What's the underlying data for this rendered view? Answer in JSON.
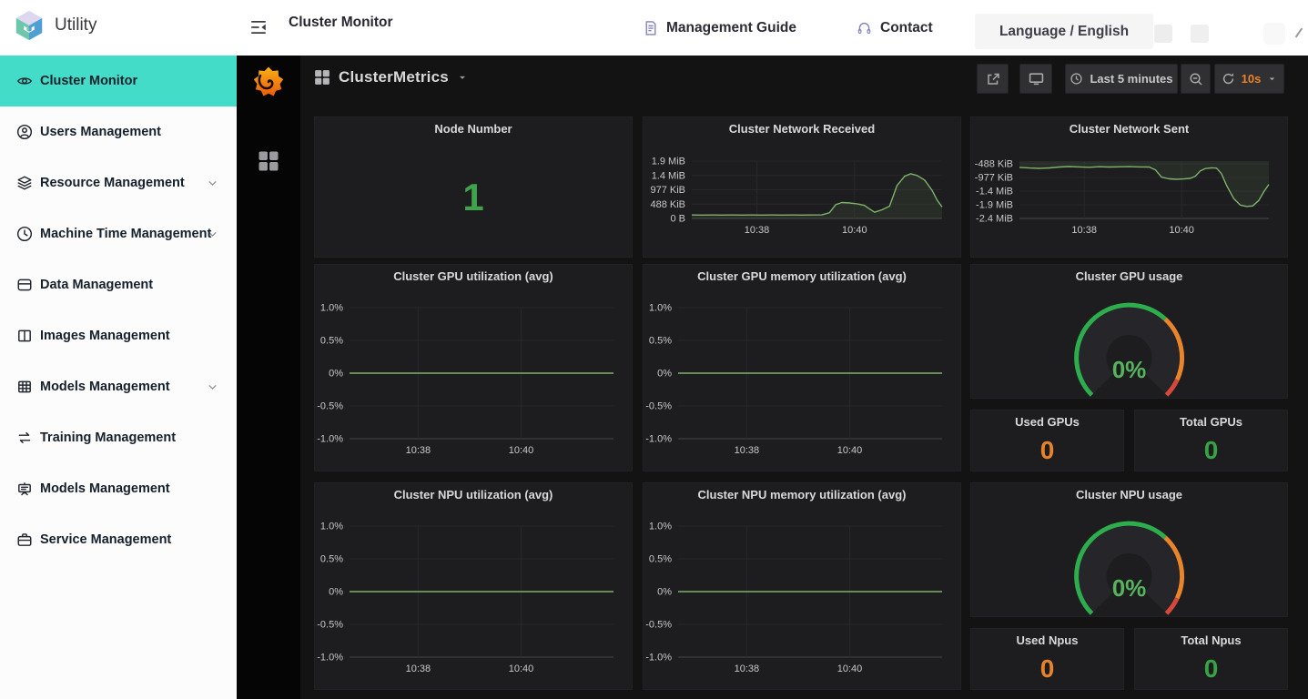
{
  "topbar": {
    "brand": "Utility",
    "page_title": "Cluster Monitor",
    "guide_label": "Management Guide",
    "contact_label": "Contact",
    "language_label": "Language / English"
  },
  "sidebar": {
    "items": [
      {
        "label": "Cluster Monitor",
        "icon": "eye",
        "active": true,
        "chevron": false
      },
      {
        "label": "Users Management",
        "icon": "user",
        "active": false,
        "chevron": false
      },
      {
        "label": "Resource Management",
        "icon": "layers",
        "active": false,
        "chevron": true
      },
      {
        "label": "Machine Time Management",
        "icon": "clock",
        "active": false,
        "chevron": true
      },
      {
        "label": "Data Management",
        "icon": "box",
        "active": false,
        "chevron": false
      },
      {
        "label": "Images Management",
        "icon": "book",
        "active": false,
        "chevron": false
      },
      {
        "label": "Models Management",
        "icon": "grid",
        "active": false,
        "chevron": true
      },
      {
        "label": "Training Management",
        "icon": "swap",
        "active": false,
        "chevron": false
      },
      {
        "label": "Models Management",
        "icon": "easel",
        "active": false,
        "chevron": false
      },
      {
        "label": "Service Management",
        "icon": "briefcase",
        "active": false,
        "chevron": false
      }
    ]
  },
  "dashboard": {
    "title": "ClusterMetrics",
    "time_range": "Last 5 minutes",
    "refresh_interval": "10s"
  },
  "colors": {
    "accent_teal": "#42dcc8",
    "stat_green": "#3fa34d",
    "stat_orange": "#e8832c",
    "line_green": "#7eb26d",
    "gauge_green": "#2dad4e",
    "gauge_orange": "#e8842a",
    "gauge_red": "#d44a3a"
  },
  "chart_data": [
    {
      "type": "stat",
      "title": "Node Number",
      "value": "1",
      "color": "#3fa34d",
      "size": 42
    },
    {
      "type": "line",
      "title": "Cluster Network Received",
      "color": "#7eb26d",
      "baseline": "bottom",
      "ylim": [
        0,
        2000
      ],
      "yticks": [
        {
          "v": 0,
          "label": "0 B"
        },
        {
          "v": 500,
          "label": "488 KiB"
        },
        {
          "v": 1000,
          "label": "977 KiB"
        },
        {
          "v": 1500,
          "label": "1.4 MiB"
        },
        {
          "v": 2000,
          "label": "1.9 MiB"
        }
      ],
      "xticks": [
        {
          "p": 0.26,
          "label": "10:38"
        },
        {
          "p": 0.65,
          "label": "10:40"
        }
      ],
      "series": [
        [
          0,
          120
        ],
        [
          0.04,
          117
        ],
        [
          0.08,
          122
        ],
        [
          0.12,
          118
        ],
        [
          0.16,
          121
        ],
        [
          0.2,
          119
        ],
        [
          0.24,
          122
        ],
        [
          0.28,
          118
        ],
        [
          0.32,
          121
        ],
        [
          0.36,
          119
        ],
        [
          0.4,
          122
        ],
        [
          0.44,
          119
        ],
        [
          0.48,
          121
        ],
        [
          0.52,
          124
        ],
        [
          0.55,
          200
        ],
        [
          0.575,
          480
        ],
        [
          0.6,
          555
        ],
        [
          0.63,
          540
        ],
        [
          0.66,
          510
        ],
        [
          0.69,
          455
        ],
        [
          0.71,
          330
        ],
        [
          0.73,
          215
        ],
        [
          0.76,
          300
        ],
        [
          0.79,
          430
        ],
        [
          0.82,
          1150
        ],
        [
          0.85,
          1470
        ],
        [
          0.875,
          1560
        ],
        [
          0.9,
          1500
        ],
        [
          0.93,
          1340
        ],
        [
          0.96,
          980
        ],
        [
          0.98,
          640
        ],
        [
          1,
          400
        ]
      ]
    },
    {
      "type": "line",
      "title": "Cluster Network Sent",
      "color": "#7eb26d",
      "baseline": "top",
      "ylim": [
        -2500,
        -400
      ],
      "yticks": [
        {
          "v": -500,
          "label": "-488 KiB"
        },
        {
          "v": -1000,
          "label": "-977 KiB"
        },
        {
          "v": -1500,
          "label": "-1.4 MiB"
        },
        {
          "v": -2000,
          "label": "-1.9 MiB"
        },
        {
          "v": -2500,
          "label": "-2.4 MiB"
        }
      ],
      "xticks": [
        {
          "p": 0.26,
          "label": "10:38"
        },
        {
          "p": 0.65,
          "label": "10:40"
        }
      ],
      "series": [
        [
          0,
          -630
        ],
        [
          0.04,
          -655
        ],
        [
          0.08,
          -668
        ],
        [
          0.12,
          -650
        ],
        [
          0.16,
          -618
        ],
        [
          0.2,
          -600
        ],
        [
          0.24,
          -612
        ],
        [
          0.28,
          -625
        ],
        [
          0.32,
          -608
        ],
        [
          0.36,
          -618
        ],
        [
          0.4,
          -610
        ],
        [
          0.44,
          -603
        ],
        [
          0.48,
          -612
        ],
        [
          0.52,
          -618
        ],
        [
          0.545,
          -720
        ],
        [
          0.57,
          -990
        ],
        [
          0.6,
          -1050
        ],
        [
          0.63,
          -1068
        ],
        [
          0.66,
          -1055
        ],
        [
          0.685,
          -1035
        ],
        [
          0.705,
          -955
        ],
        [
          0.725,
          -760
        ],
        [
          0.745,
          -672
        ],
        [
          0.77,
          -645
        ],
        [
          0.79,
          -658
        ],
        [
          0.81,
          -860
        ],
        [
          0.83,
          -1280
        ],
        [
          0.86,
          -1780
        ],
        [
          0.885,
          -2010
        ],
        [
          0.91,
          -2060
        ],
        [
          0.935,
          -2045
        ],
        [
          0.96,
          -1840
        ],
        [
          0.98,
          -1520
        ],
        [
          1,
          -1255
        ]
      ]
    },
    {
      "type": "line",
      "title": "Cluster GPU utilization (avg)",
      "color": "#7eb26d",
      "baseline": "none",
      "ylim": [
        -1,
        1
      ],
      "yticks": [
        {
          "v": 1,
          "label": "1.0%"
        },
        {
          "v": 0.5,
          "label": "0.5%"
        },
        {
          "v": 0,
          "label": "0%"
        },
        {
          "v": -0.5,
          "label": "-0.5%"
        },
        {
          "v": -1,
          "label": "-1.0%"
        }
      ],
      "xticks": [
        {
          "p": 0.26,
          "label": "10:38"
        },
        {
          "p": 0.65,
          "label": "10:40"
        }
      ],
      "series": [
        [
          0,
          0
        ],
        [
          1,
          0
        ]
      ]
    },
    {
      "type": "line",
      "title": "Cluster GPU memory utilization (avg)",
      "color": "#7eb26d",
      "baseline": "none",
      "ylim": [
        -1,
        1
      ],
      "yticks": [
        {
          "v": 1,
          "label": "1.0%"
        },
        {
          "v": 0.5,
          "label": "0.5%"
        },
        {
          "v": 0,
          "label": "0%"
        },
        {
          "v": -0.5,
          "label": "-0.5%"
        },
        {
          "v": -1,
          "label": "-1.0%"
        }
      ],
      "xticks": [
        {
          "p": 0.26,
          "label": "10:38"
        },
        {
          "p": 0.65,
          "label": "10:40"
        }
      ],
      "series": [
        [
          0,
          0
        ],
        [
          1,
          0
        ]
      ]
    },
    {
      "type": "gauge",
      "title": "Cluster GPU usage",
      "value_text": "0%",
      "value_color": "#56b45d",
      "segments": [
        {
          "c": "#2dad4e",
          "f": 0.66
        },
        {
          "c": "#e8842a",
          "f": 0.265
        },
        {
          "c": "#d44a3a",
          "f": 0.075
        }
      ]
    },
    {
      "type": "stat",
      "title": "Used GPUs",
      "value": "0",
      "color": "#e8832c",
      "size": 28
    },
    {
      "type": "stat",
      "title": "Total GPUs",
      "value": "0",
      "color": "#38a345",
      "size": 28
    },
    {
      "type": "line",
      "title": "Cluster NPU utilization (avg)",
      "color": "#7eb26d",
      "baseline": "none",
      "ylim": [
        -1,
        1
      ],
      "yticks": [
        {
          "v": 1,
          "label": "1.0%"
        },
        {
          "v": 0.5,
          "label": "0.5%"
        },
        {
          "v": 0,
          "label": "0%"
        },
        {
          "v": -0.5,
          "label": "-0.5%"
        },
        {
          "v": -1,
          "label": "-1.0%"
        }
      ],
      "xticks": [
        {
          "p": 0.26,
          "label": "10:38"
        },
        {
          "p": 0.65,
          "label": "10:40"
        }
      ],
      "series": [
        [
          0,
          0
        ],
        [
          1,
          0
        ]
      ]
    },
    {
      "type": "line",
      "title": "Cluster NPU memory utilization (avg)",
      "color": "#7eb26d",
      "baseline": "none",
      "ylim": [
        -1,
        1
      ],
      "yticks": [
        {
          "v": 1,
          "label": "1.0%"
        },
        {
          "v": 0.5,
          "label": "0.5%"
        },
        {
          "v": 0,
          "label": "0%"
        },
        {
          "v": -0.5,
          "label": "-0.5%"
        },
        {
          "v": -1,
          "label": "-1.0%"
        }
      ],
      "xticks": [
        {
          "p": 0.26,
          "label": "10:38"
        },
        {
          "p": 0.65,
          "label": "10:40"
        }
      ],
      "series": [
        [
          0,
          0
        ],
        [
          1,
          0
        ]
      ]
    },
    {
      "type": "gauge",
      "title": "Cluster NPU usage",
      "value_text": "0%",
      "value_color": "#56b45d",
      "segments": [
        {
          "c": "#2dad4e",
          "f": 0.66
        },
        {
          "c": "#e8842a",
          "f": 0.265
        },
        {
          "c": "#d44a3a",
          "f": 0.075
        }
      ]
    },
    {
      "type": "stat",
      "title": "Used Npus",
      "value": "0",
      "color": "#e8832c",
      "size": 28
    },
    {
      "type": "stat",
      "title": "Total Npus",
      "value": "0",
      "color": "#38a345",
      "size": 28
    }
  ]
}
